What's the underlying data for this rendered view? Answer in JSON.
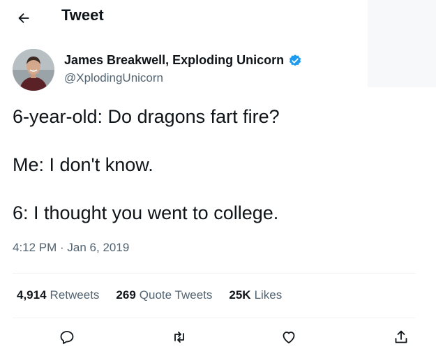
{
  "header": {
    "title": "Tweet",
    "back_icon": "arrow-left-icon"
  },
  "author": {
    "name": "James Breakwell, Exploding Unicorn",
    "handle": "@XplodingUnicorn",
    "verified": true,
    "verified_color": "#1d9bf0"
  },
  "tweet": {
    "lines": [
      "6-year-old: Do dragons fart fire?",
      "Me: I don't know.",
      "6: I thought you went to college."
    ],
    "timestamp": "4:12 PM · Jan 6, 2019"
  },
  "stats": {
    "retweets": {
      "count": "4,914",
      "label": "Retweets"
    },
    "quotes": {
      "count": "269",
      "label": "Quote Tweets"
    },
    "likes": {
      "count": "25K",
      "label": "Likes"
    }
  },
  "actions": [
    "reply-icon",
    "retweet-icon",
    "like-icon",
    "share-icon"
  ],
  "colors": {
    "text": "#0f1419",
    "secondary": "#536471",
    "divider": "#eff3f4"
  }
}
